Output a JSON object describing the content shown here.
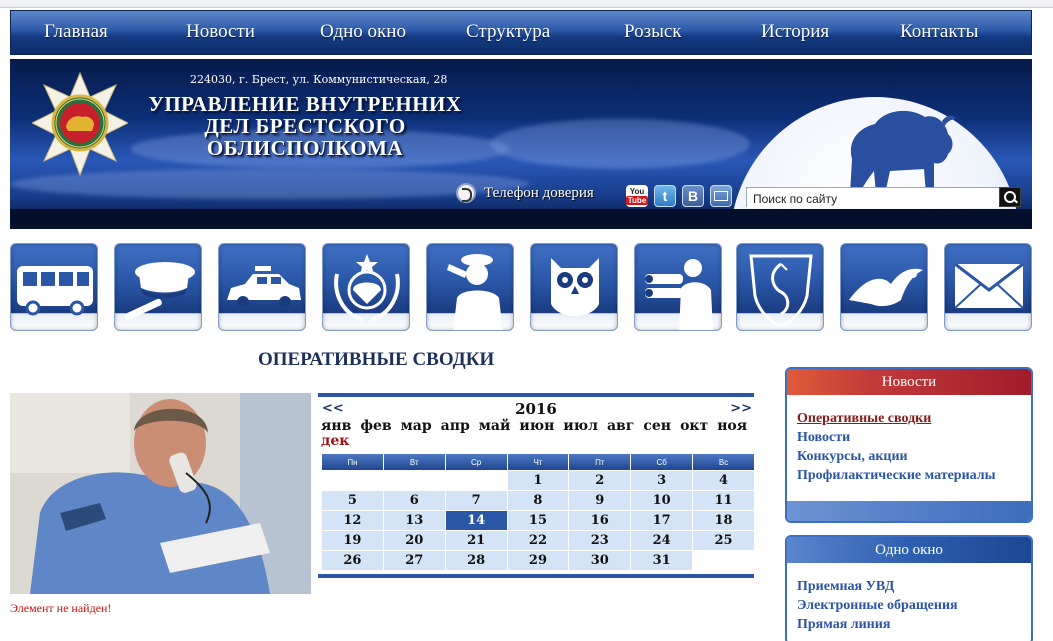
{
  "nav": {
    "items": [
      {
        "label": "Главная"
      },
      {
        "label": "Новости"
      },
      {
        "label": "Одно окно"
      },
      {
        "label": "Структура"
      },
      {
        "label": "Розыск"
      },
      {
        "label": "История"
      },
      {
        "label": "Контакты"
      }
    ]
  },
  "header": {
    "address": "224030, г. Брест, ул. Коммунистическая, 28",
    "title_lines": [
      "УПРАВЛЕНИЕ ВНУТРЕННИХ",
      "ДЕЛ БРЕСТСКОГО",
      "ОБЛИСПОЛКОМА"
    ],
    "hotline_label": "Телефон доверия",
    "social": {
      "youtube_top": "You",
      "youtube_bottom": "Tube",
      "twitter": "t",
      "vk": "B"
    },
    "search_value": "Поиск по сайту"
  },
  "icon_row": [
    {
      "name": "bus-icon"
    },
    {
      "name": "traffic-police-cap-icon"
    },
    {
      "name": "police-car-icon"
    },
    {
      "name": "coat-of-arms-icon"
    },
    {
      "name": "saluting-officer-icon"
    },
    {
      "name": "owl-icon"
    },
    {
      "name": "binoculars-icon"
    },
    {
      "name": "snake-shield-icon"
    },
    {
      "name": "eagle-icon"
    },
    {
      "name": "envelope-icon"
    }
  ],
  "main": {
    "heading": "ОПЕРАТИВНЫЕ СВОДКИ",
    "error_text": "Элемент не найден!"
  },
  "calendar": {
    "prev": "<<",
    "next": ">>",
    "year": "2016",
    "months": [
      "янв",
      "фев",
      "мар",
      "апр",
      "май",
      "июн",
      "июл",
      "авг",
      "сен",
      "окт",
      "ноя",
      "дек"
    ],
    "active_month": "дек",
    "weekdays": [
      "Пн",
      "Вт",
      "Ср",
      "Чт",
      "Пт",
      "Сб",
      "Вс"
    ],
    "weeks": [
      [
        "",
        "",
        "",
        "1",
        "2",
        "3",
        "4"
      ],
      [
        "5",
        "6",
        "7",
        "8",
        "9",
        "10",
        "11"
      ],
      [
        "12",
        "13",
        "14",
        "15",
        "16",
        "17",
        "18"
      ],
      [
        "19",
        "20",
        "21",
        "22",
        "23",
        "24",
        "25"
      ],
      [
        "26",
        "27",
        "28",
        "29",
        "30",
        "31",
        ""
      ]
    ],
    "today": "14"
  },
  "sidebar": {
    "news": {
      "title": "Новости",
      "links": [
        "Оперативные сводки",
        "Новости",
        "Конкурсы, акции",
        "Профилактические материалы"
      ],
      "current": "Оперативные сводки"
    },
    "one_window": {
      "title": "Одно окно",
      "links": [
        "Приемная УВД",
        "Электронные обращения",
        "Прямая линия"
      ]
    }
  },
  "colors": {
    "nav_blue": "#2d5aa8",
    "link_blue": "#2a55a8",
    "active_red": "#8c1818",
    "news_header_red": "#c23a38",
    "error_red": "#cc1111"
  }
}
